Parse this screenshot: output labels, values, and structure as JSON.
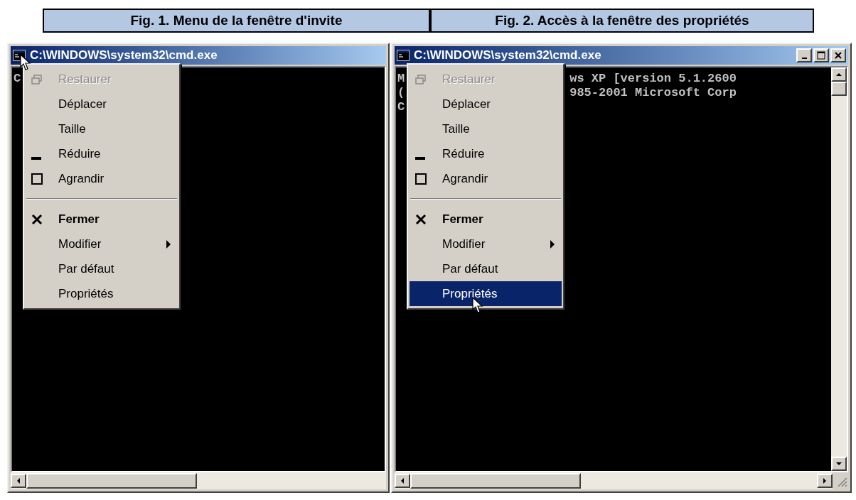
{
  "figures": [
    {
      "caption": "Fig. 1. Menu de la fenêtre d'invite",
      "window": {
        "title": "C:\\WINDOWS\\system32\\cmd.exe",
        "caption_buttons": false,
        "vertical_scrollbar": false,
        "console_lines": [
          {
            "left": "C"
          }
        ],
        "menu": [
          {
            "kind": "restore",
            "label": "Restaurer",
            "disabled": true,
            "default": false,
            "selected": false
          },
          {
            "kind": "plain",
            "label": "Déplacer",
            "disabled": false,
            "default": false,
            "selected": false
          },
          {
            "kind": "plain",
            "label": "Taille",
            "disabled": false,
            "default": false,
            "selected": false
          },
          {
            "kind": "minimize",
            "label": "Réduire",
            "disabled": false,
            "default": false,
            "selected": false
          },
          {
            "kind": "maximize",
            "label": "Agrandir",
            "disabled": false,
            "default": false,
            "selected": false
          },
          {
            "kind": "separator"
          },
          {
            "kind": "close",
            "label": "Fermer",
            "disabled": false,
            "default": true,
            "selected": false
          },
          {
            "kind": "submenu",
            "label": "Modifier",
            "disabled": false,
            "default": false,
            "selected": false
          },
          {
            "kind": "plain",
            "label": "Par défaut",
            "disabled": false,
            "default": false,
            "selected": false
          },
          {
            "kind": "plain",
            "label": "Propriétés",
            "disabled": false,
            "default": false,
            "selected": false
          }
        ]
      }
    },
    {
      "caption": "Fig. 2. Accès à la fenêtre des propriétés",
      "window": {
        "title": "C:\\WINDOWS\\system32\\cmd.exe",
        "caption_buttons": true,
        "vertical_scrollbar": true,
        "console_lines": [
          {
            "left": "M",
            "right": "ws XP [version 5.1.2600"
          },
          {
            "left": "(",
            "right": "985-2001 Microsoft Corp"
          },
          {
            "left": "C"
          }
        ],
        "menu": [
          {
            "kind": "restore",
            "label": "Restaurer",
            "disabled": true,
            "default": false,
            "selected": false
          },
          {
            "kind": "plain",
            "label": "Déplacer",
            "disabled": false,
            "default": false,
            "selected": false
          },
          {
            "kind": "plain",
            "label": "Taille",
            "disabled": false,
            "default": false,
            "selected": false
          },
          {
            "kind": "minimize",
            "label": "Réduire",
            "disabled": false,
            "default": false,
            "selected": false
          },
          {
            "kind": "maximize",
            "label": "Agrandir",
            "disabled": false,
            "default": false,
            "selected": false
          },
          {
            "kind": "separator"
          },
          {
            "kind": "close",
            "label": "Fermer",
            "disabled": false,
            "default": true,
            "selected": false
          },
          {
            "kind": "submenu",
            "label": "Modifier",
            "disabled": false,
            "default": false,
            "selected": false
          },
          {
            "kind": "plain",
            "label": "Par défaut",
            "disabled": false,
            "default": false,
            "selected": false
          },
          {
            "kind": "plain",
            "label": "Propriétés",
            "disabled": false,
            "default": false,
            "selected": true
          }
        ]
      }
    }
  ]
}
